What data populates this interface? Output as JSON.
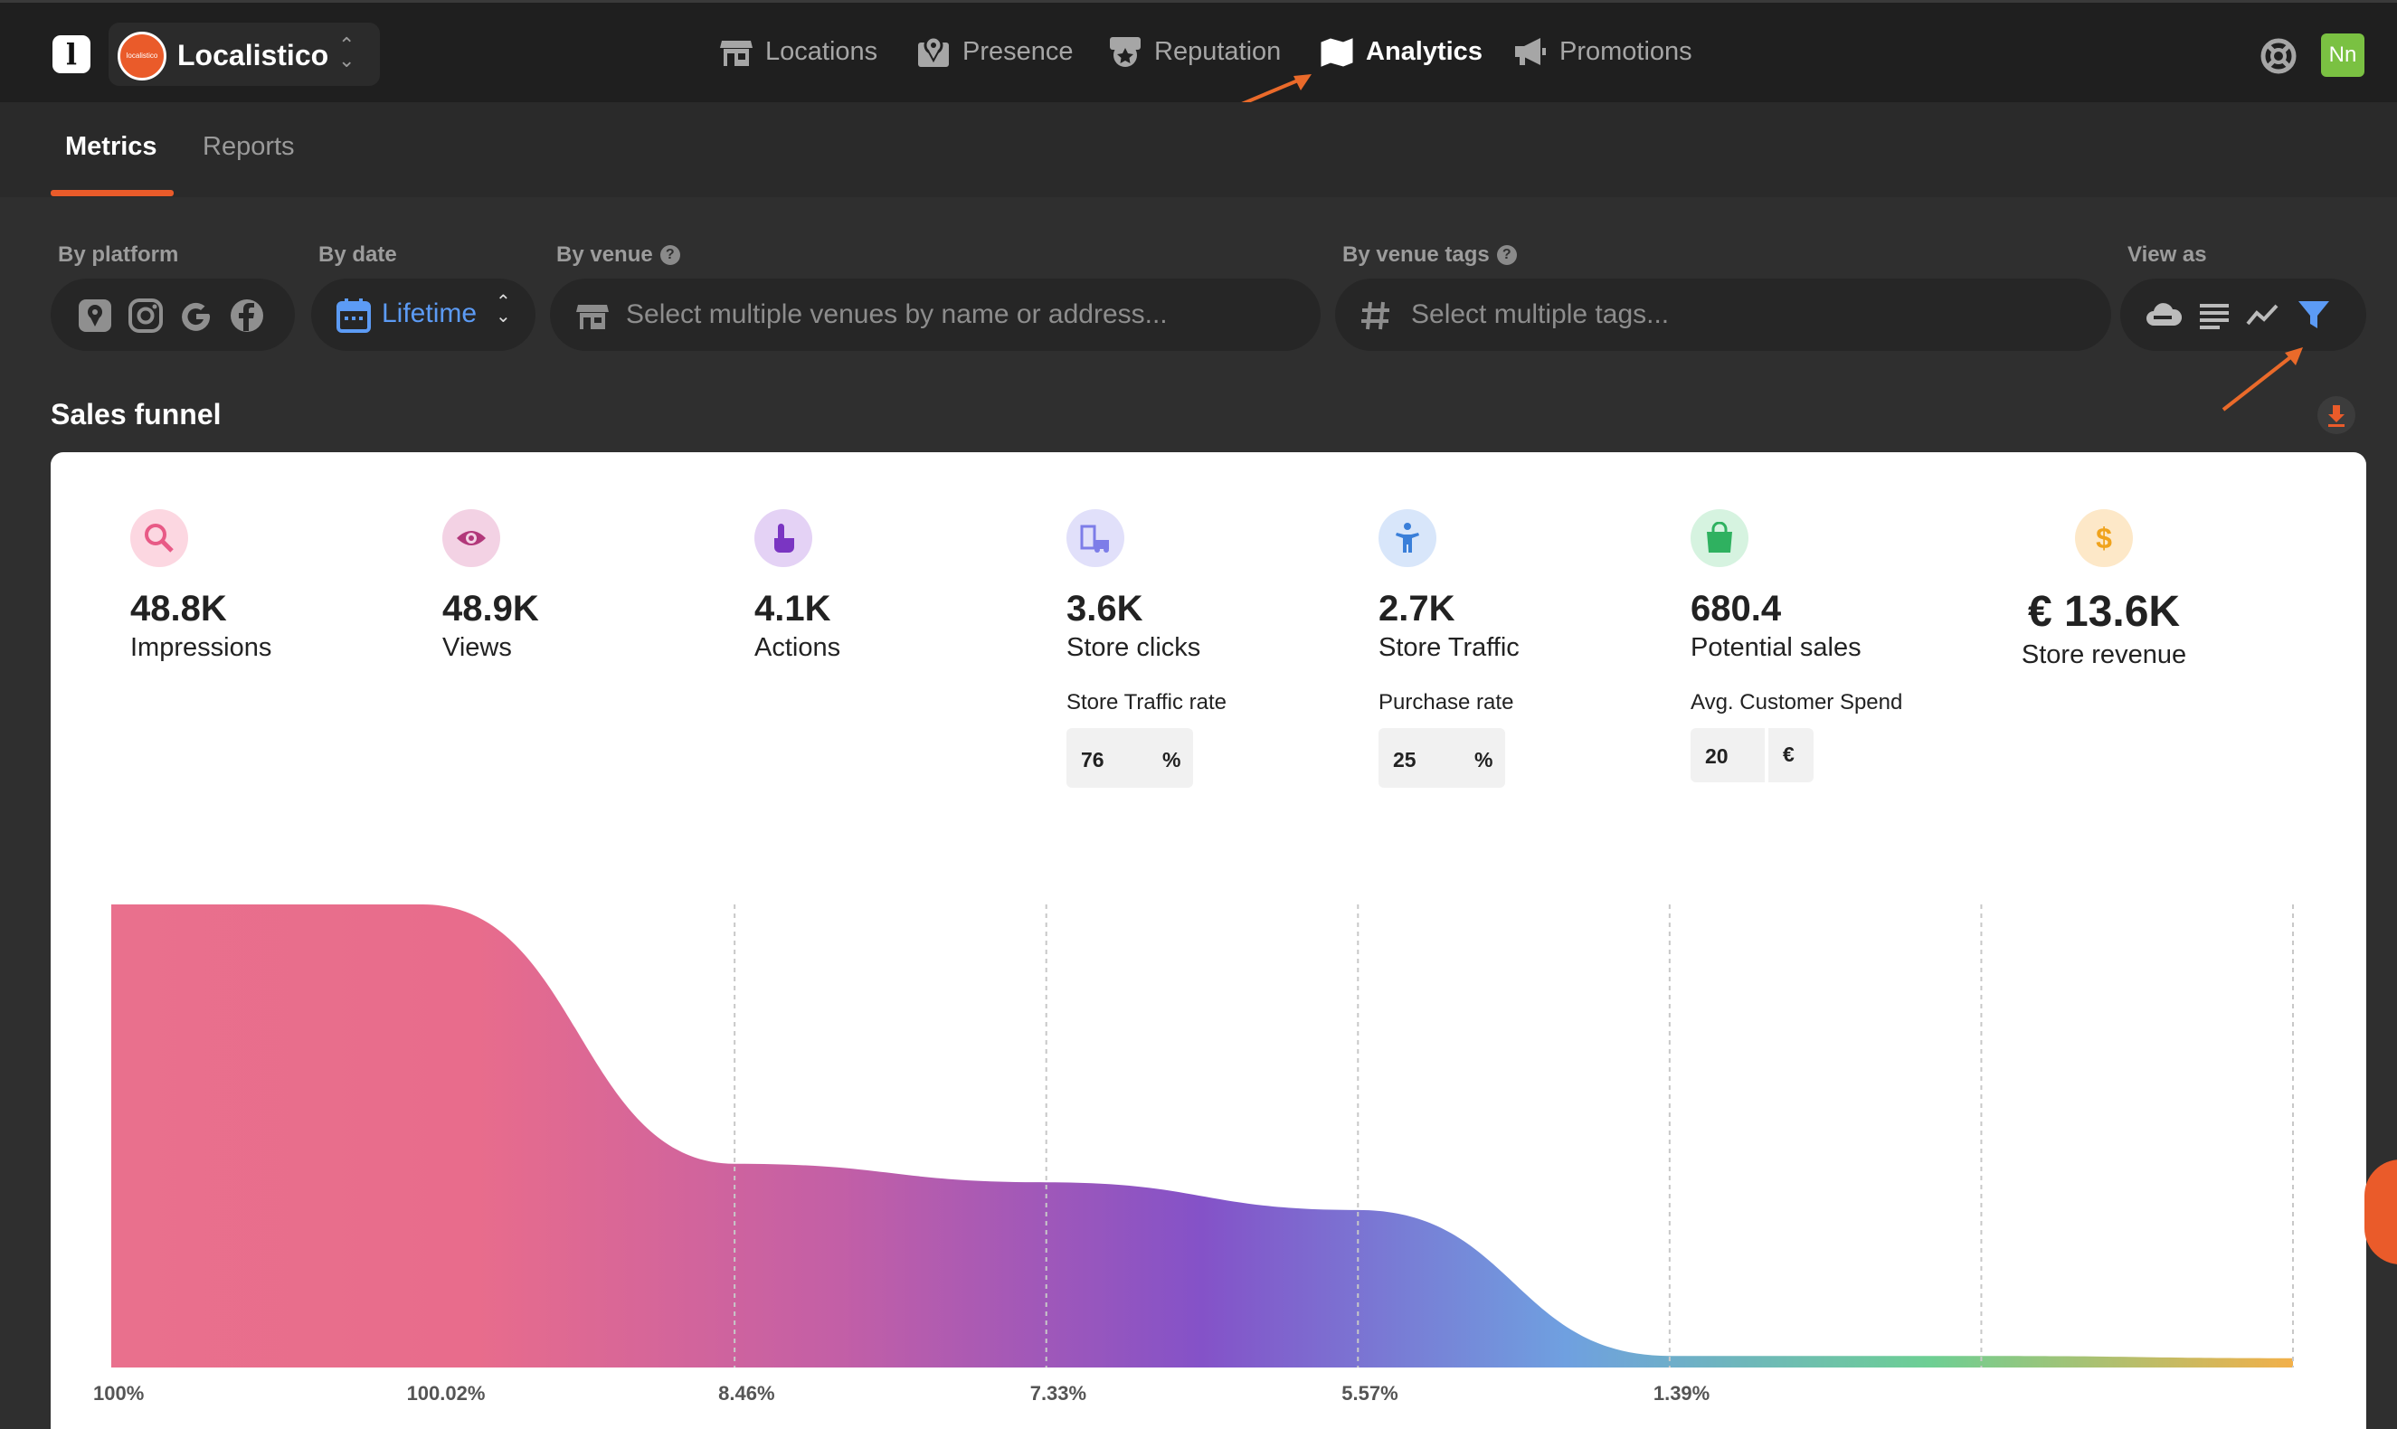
{
  "app": {
    "logo_letter": "l",
    "org_name": "Localistico",
    "org_avatar_text": "localistico"
  },
  "nav": {
    "items": [
      {
        "label": "Locations",
        "active": false
      },
      {
        "label": "Presence",
        "active": false
      },
      {
        "label": "Reputation",
        "active": false
      },
      {
        "label": "Analytics",
        "active": true
      },
      {
        "label": "Promotions",
        "active": false
      }
    ],
    "user_initials": "Nn"
  },
  "subtabs": [
    {
      "label": "Metrics",
      "active": true
    },
    {
      "label": "Reports",
      "active": false
    }
  ],
  "filters": {
    "platform_label": "By platform",
    "platforms": [
      "google-maps-icon",
      "instagram-icon",
      "google-icon",
      "facebook-icon"
    ],
    "date_label": "By date",
    "date_value": "Lifetime",
    "venue_label": "By venue",
    "venue_placeholder": "Select multiple venues by name or address...",
    "tags_label": "By venue tags",
    "tags_placeholder": "Select multiple tags...",
    "help_glyph": "?",
    "view_label": "View as",
    "view_options": [
      "cloud-icon",
      "list-icon",
      "line-chart-icon",
      "funnel-icon"
    ],
    "view_selected": "funnel-icon"
  },
  "section": {
    "title": "Sales funnel"
  },
  "metrics": [
    {
      "value": "48.8K",
      "label": "Impressions",
      "icon": "search-icon",
      "icon_bg": "#fcd7e1",
      "icon_color": "#e85a86"
    },
    {
      "value": "48.9K",
      "label": "Views",
      "icon": "eye-icon",
      "icon_bg": "#f3d2e4",
      "icon_color": "#b2387a"
    },
    {
      "value": "4.1K",
      "label": "Actions",
      "icon": "tap-icon",
      "icon_bg": "#e4d2f5",
      "icon_color": "#7a35c2"
    },
    {
      "value": "3.6K",
      "label": "Store clicks",
      "icon": "store-car-icon",
      "icon_bg": "#e1e0fa",
      "icon_color": "#7d7de8",
      "rate_label": "Store Traffic rate",
      "rate_value": "76",
      "rate_unit": "%"
    },
    {
      "value": "2.7K",
      "label": "Store Traffic",
      "icon": "person-icon",
      "icon_bg": "#d8e6fa",
      "icon_color": "#3a7fd9",
      "rate_label": "Purchase rate",
      "rate_value": "25",
      "rate_unit": "%"
    },
    {
      "value": "680.4",
      "label": "Potential sales",
      "icon": "shopping-bag-icon",
      "icon_bg": "#d6f3e0",
      "icon_color": "#2fb160",
      "rate_label": "Avg. Customer Spend",
      "rate_value": "20",
      "rate_unit": "€"
    }
  ],
  "revenue": {
    "value": "€ 13.6K",
    "label": "Store revenue",
    "icon": "dollar-icon",
    "icon_bg": "#fde8c8",
    "icon_color": "#f0a31c"
  },
  "funnel": {
    "stages": [
      "Impressions",
      "Views",
      "Actions",
      "Store clicks",
      "Store Traffic",
      "Potential sales",
      "Store revenue"
    ],
    "percentages": [
      "100%",
      "100.02%",
      "8.46%",
      "7.33%",
      "5.57%",
      "1.39%"
    ],
    "levels": [
      1.0,
      1.0,
      0.44,
      0.4,
      0.34,
      0.025,
      0.025,
      0.02
    ],
    "gradient": [
      "#e9708d",
      "#e86c8c",
      "#c35fa6",
      "#8452c8",
      "#6fa0e0",
      "#6dcf94",
      "#f2b04a"
    ]
  },
  "colors": {
    "accent": "#ea5b2a",
    "date_blue": "#5c9bf5",
    "nav_bg": "#1f1f1f",
    "page_bg": "#2f2f2f"
  }
}
